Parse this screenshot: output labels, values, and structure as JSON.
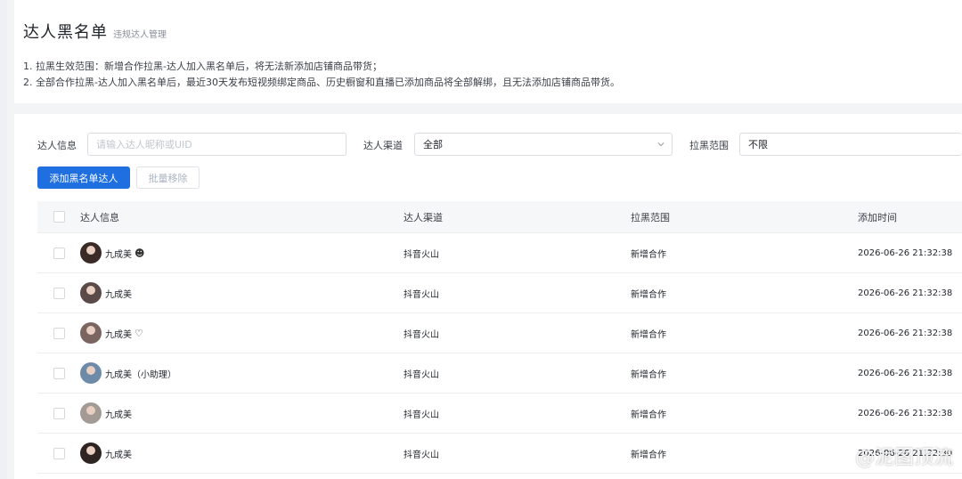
{
  "header": {
    "title": "达人黑名单",
    "subtitle": "违规达人管理"
  },
  "notes": [
    "1. 拉黑生效范围：新增合作拉黑-达人加入黑名单后，将无法新添加店铺商品带货；",
    "2. 全部合作拉黑-达人加入黑名单后，最近30天发布短视频绑定商品、历史橱窗和直播已添加商品将全部解绑，且无法添加店铺商品带货。"
  ],
  "filters": {
    "talent_info_label": "达人信息",
    "talent_info_placeholder": "请输入达人昵称或UID",
    "channel_label": "达人渠道",
    "channel_value": "全部",
    "range_label": "拉黑范围",
    "range_value": "不限"
  },
  "actions": {
    "add_label": "添加黑名单达人",
    "batch_remove_label": "批量移除"
  },
  "table": {
    "columns": [
      "达人信息",
      "达人渠道",
      "拉黑范围",
      "添加时间"
    ],
    "rows": [
      {
        "name": "九成美",
        "icon": "ghost-icon",
        "channel": "抖音火山",
        "range": "新增合作",
        "time": "2026-06-26 21:32:38"
      },
      {
        "name": "九成美",
        "icon": "",
        "channel": "抖音火山",
        "range": "新增合作",
        "time": "2026-06-26 21:32:38"
      },
      {
        "name": "九成美",
        "icon": "heart-icon",
        "channel": "抖音火山",
        "range": "新增合作",
        "time": "2026-06-26 21:32:38"
      },
      {
        "name": "九成美（小助理）",
        "icon": "",
        "channel": "抖音火山",
        "range": "新增合作",
        "time": "2026-06-26 21:32:38"
      },
      {
        "name": "九成美",
        "icon": "",
        "channel": "抖音火山",
        "range": "新增合作",
        "time": "2026-06-26 21:32:38"
      },
      {
        "name": "九成美",
        "icon": "",
        "channel": "抖音火山",
        "range": "新增合作",
        "time": "2026-06-26 21:32:30"
      }
    ]
  },
  "watermark": {
    "text": "@泥图顶流"
  },
  "colors": {
    "primary": "#1f6fe0",
    "disabled_text": "#a9b4c4",
    "page_bg": "#f3f4f6"
  }
}
